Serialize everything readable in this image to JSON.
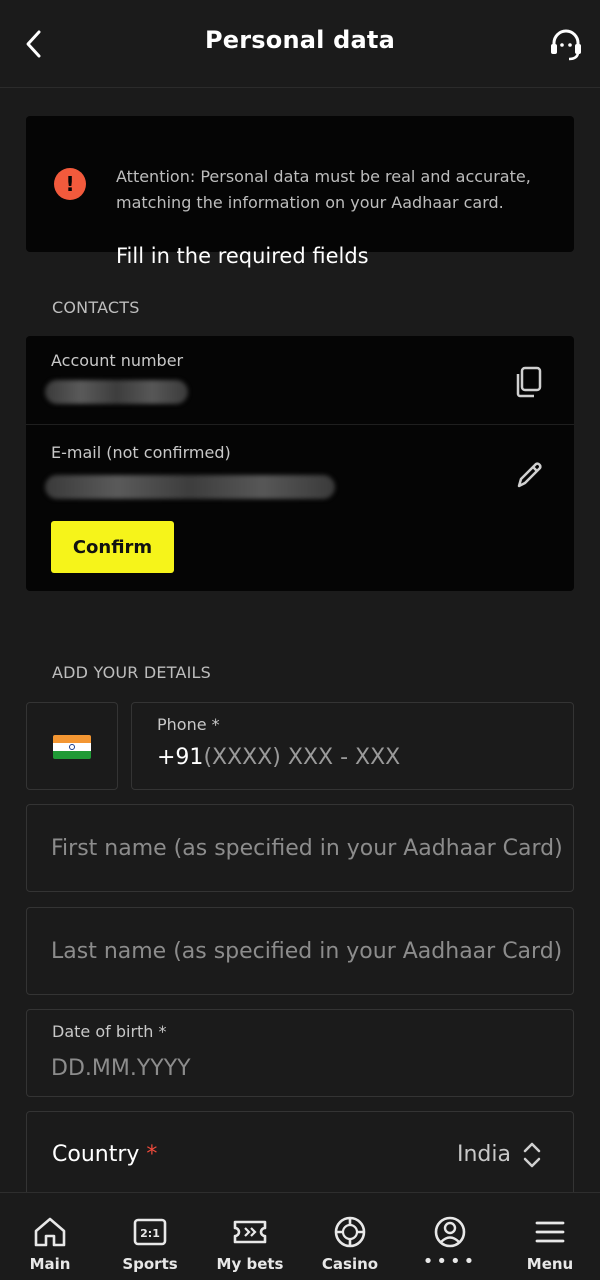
{
  "header": {
    "title": "Personal data"
  },
  "alert": {
    "title": "Fill in the required fields",
    "text": "Attention: Personal data must be real and accurate, matching the information on your Aadhaar card.",
    "icon_text": "!"
  },
  "contacts": {
    "section_label": "CONTACTS",
    "account_label": "Account number",
    "email_label": "E-mail (not confirmed)",
    "confirm_label": "Confirm"
  },
  "details": {
    "section_label": "ADD YOUR DETAILS",
    "phone_label": "Phone *",
    "phone_code": "+91",
    "phone_mask": "(XXXX) XXX - XXX",
    "first_name_placeholder": "First name (as specified in your Aadhaar Card)",
    "last_name_placeholder": "Last name (as specified in your Aadhaar Card)",
    "dob_label": "Date of birth *",
    "dob_placeholder": "DD.MM.YYYY",
    "country_label": "Country",
    "country_required": "*",
    "country_value": "India"
  },
  "nav": {
    "items": [
      {
        "label": "Main",
        "icon": "home-icon"
      },
      {
        "label": "Sports",
        "icon": "scoreboard-icon"
      },
      {
        "label": "My bets",
        "icon": "ticket-icon"
      },
      {
        "label": "Casino",
        "icon": "casino-chip-icon"
      },
      {
        "label": "••••",
        "icon": "profile-icon"
      },
      {
        "label": "Menu",
        "icon": "hamburger-icon"
      }
    ]
  }
}
